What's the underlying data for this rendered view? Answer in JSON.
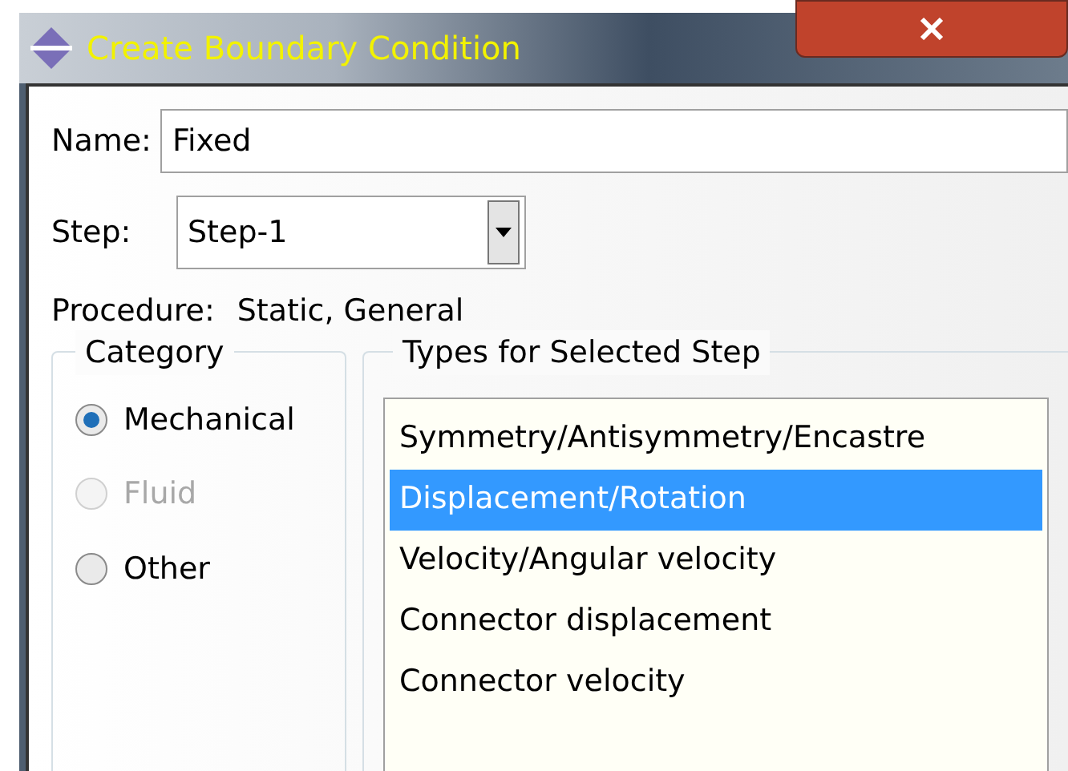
{
  "window": {
    "title": "Create Boundary Condition"
  },
  "name_field": {
    "label": "Name:",
    "value": "Fixed"
  },
  "step_field": {
    "label": "Step:",
    "value": "Step-1"
  },
  "procedure": {
    "label": "Procedure:",
    "value": "Static, General"
  },
  "category": {
    "title": "Category",
    "options": [
      {
        "label": "Mechanical",
        "selected": true,
        "disabled": false
      },
      {
        "label": "Fluid",
        "selected": false,
        "disabled": true
      },
      {
        "label": "Other",
        "selected": false,
        "disabled": false
      }
    ]
  },
  "types": {
    "title": "Types for Selected Step",
    "items": [
      {
        "label": "Symmetry/Antisymmetry/Encastre",
        "selected": false
      },
      {
        "label": "Displacement/Rotation",
        "selected": true
      },
      {
        "label": "Velocity/Angular velocity",
        "selected": false
      },
      {
        "label": "Connector displacement",
        "selected": false
      },
      {
        "label": "Connector velocity",
        "selected": false
      }
    ]
  }
}
